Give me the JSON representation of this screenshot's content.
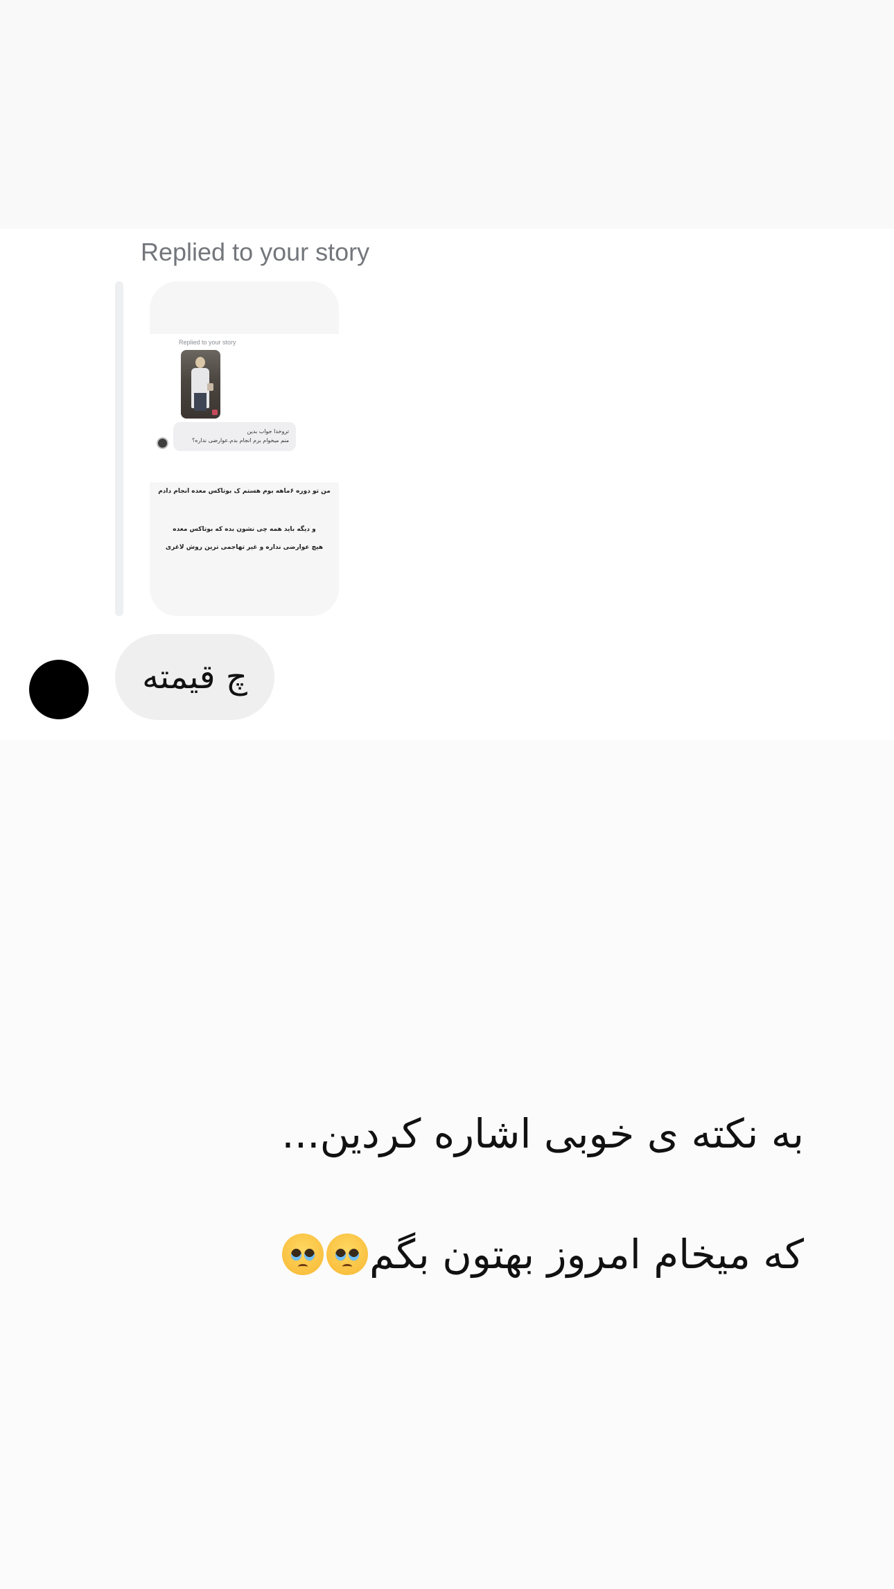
{
  "dm_thread": {
    "replied_label": "Replied to your story",
    "story_preview": {
      "mini_replied_label": "Replied to your story",
      "mini_message_line1": "تروخدا جواب بدین",
      "mini_message_line2": "منم میخوام برم انجام بدم.عوارضی نداره؟",
      "text_line1": "من تو دوره ۶ماهه بوم هستم ک بوتاکس معده انجام دادم",
      "text_line2": "و دیگه باید همه چی نشون بده که بوتاکس معده",
      "text_line3": "هیچ عوارضی نداره و غیر تهاجمی ترین روش لاغری"
    },
    "incoming_message": "چ قیمته"
  },
  "caption": {
    "line1": "به نکته ی خوبی اشاره کردین...",
    "line2": "که میخام امروز بهتون بگم",
    "emoji_1": "pleading-face",
    "emoji_2": "pleading-face"
  }
}
